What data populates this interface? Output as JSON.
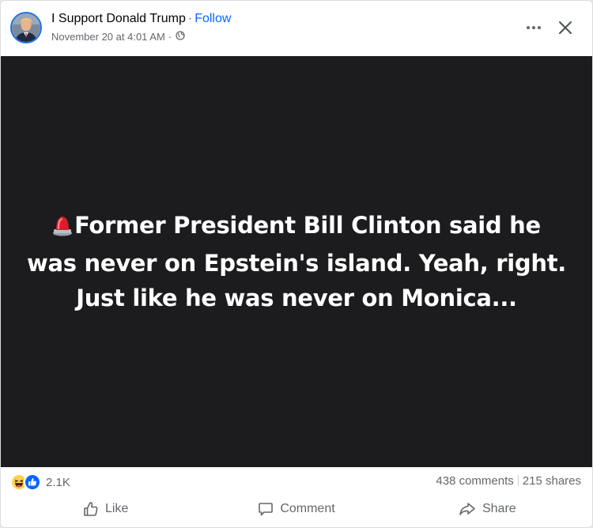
{
  "header": {
    "page_name": "I Support Donald Trump",
    "separator": "·",
    "follow_label": "Follow",
    "timestamp": "November 20 at 4:01 AM",
    "meta_separator": "·",
    "audience_icon": "globe-icon",
    "more_icon": "more-dots-icon",
    "close_icon": "close-icon"
  },
  "post": {
    "emoji_icon": "siren-icon",
    "text": "Former President Bill Clinton said he was never on Epstein's island. Yeah, right. Just like he was never on Monica...",
    "background_color": "#1c1c1e",
    "text_color": "#ffffff"
  },
  "stats": {
    "reaction_icons": [
      "haha-icon",
      "like-icon"
    ],
    "reaction_count": "2.1K",
    "comments": "438 comments",
    "shares": "215 shares"
  },
  "actions": {
    "like_label": "Like",
    "comment_label": "Comment",
    "share_label": "Share"
  },
  "colors": {
    "accent": "#0866ff",
    "secondary_text": "#65676b",
    "avatar_ring": "#1b74e4"
  }
}
